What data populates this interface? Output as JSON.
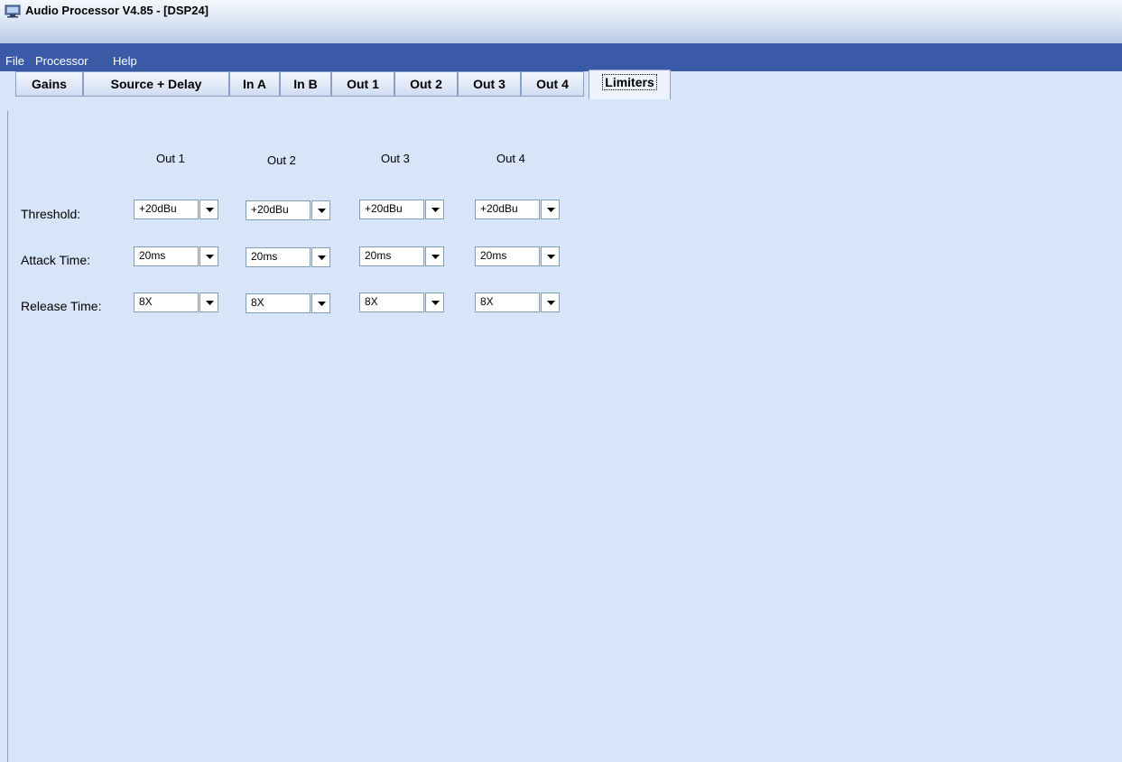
{
  "window": {
    "title": "Audio Processor V4.85 - [DSP24]",
    "icon": "monitor-icon"
  },
  "menu": {
    "items": [
      "File",
      "Processor",
      "Help"
    ]
  },
  "tabs": [
    {
      "label": "Gains"
    },
    {
      "label": "Source + Delay"
    },
    {
      "label": "In A"
    },
    {
      "label": "In B"
    },
    {
      "label": "Out 1"
    },
    {
      "label": "Out 2"
    },
    {
      "label": "Out 3"
    },
    {
      "label": "Out 4"
    },
    {
      "label": "Limiters",
      "active": true
    }
  ],
  "limiters": {
    "columns": [
      "Out 1",
      "Out 2",
      "Out 3",
      "Out 4"
    ],
    "rows": [
      {
        "label": "Threshold:",
        "values": [
          "+20dBu",
          "+20dBu",
          "+20dBu",
          "+20dBu"
        ]
      },
      {
        "label": "Attack Time:",
        "values": [
          "20ms",
          "20ms",
          "20ms",
          "20ms"
        ]
      },
      {
        "label": "Release Time:",
        "values": [
          "8X",
          "8X",
          "8X",
          "8X"
        ]
      }
    ]
  }
}
